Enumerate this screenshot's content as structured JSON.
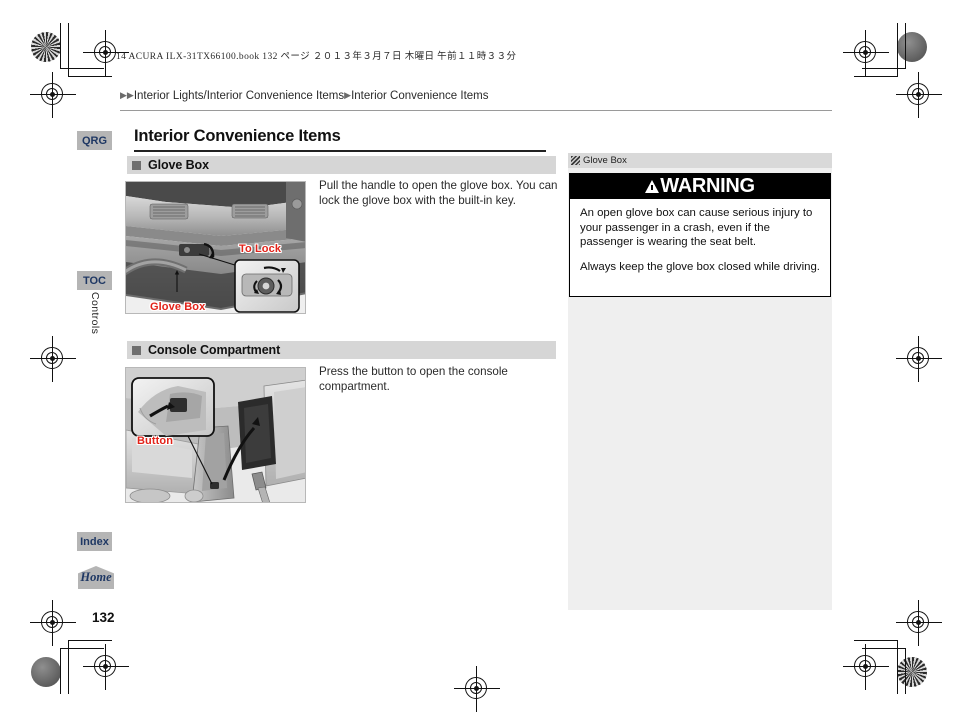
{
  "print_imprint": "14 ACURA ILX-31TX66100.book   132 ページ   ２０１３年３月７日   木曜日   午前１１時３３分",
  "breadcrumb": {
    "arrow_double": "▶▶",
    "arrow_single": "▶",
    "part1": "Interior Lights/Interior Convenience Items",
    "part2": "Interior Convenience Items"
  },
  "page_title": "Interior Convenience Items",
  "page_number": "132",
  "sections": [
    {
      "heading": "Glove Box",
      "body": "Pull the handle to open the glove box. You can lock the glove box with the built-in key.",
      "figure_callouts": [
        "To Lock",
        "Glove Box"
      ]
    },
    {
      "heading": "Console Compartment",
      "body": "Press the button to open the console compartment.",
      "figure_callouts": [
        "Button"
      ]
    }
  ],
  "info_panel": {
    "head_label": "Glove Box",
    "head_icon": "hatched-square-icon",
    "warning": {
      "title": "WARNING",
      "icon": "warning-triangle-icon",
      "paragraphs": [
        "An open glove box can cause serious injury to your passenger in a crash, even if the passenger is wearing the seat belt.",
        "Always keep the glove box closed while driving."
      ]
    }
  },
  "nav_tabs": [
    {
      "label": "QRG",
      "name": "qrg"
    },
    {
      "label": "TOC",
      "name": "toc"
    },
    {
      "label": "Index",
      "name": "index"
    },
    {
      "label": "Home",
      "name": "home"
    }
  ],
  "chapter_label": "Controls",
  "colors": {
    "callout_red": "#e2231a",
    "tab_blue": "#1f3864",
    "tab_gray": "#b5b5b5",
    "section_bar_gray": "#d6d6d6",
    "info_panel_gray": "#efefef"
  }
}
